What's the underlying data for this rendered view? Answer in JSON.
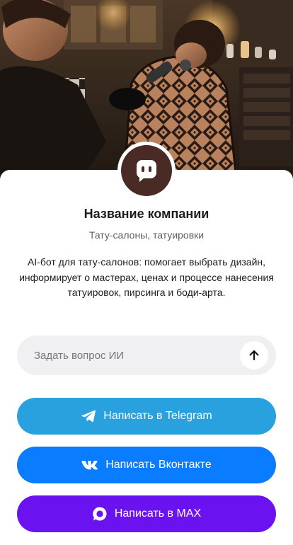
{
  "hero": {
    "image_icon": "tattoo-salon-photo"
  },
  "company": {
    "avatar_icon": "chat-bot-icon",
    "avatar_color": "#4a2a24",
    "name": "Название компании",
    "category": "Тату-салоны, татуировки",
    "description": "AI-бот для тату-салонов: помогает выбрать дизайн, информирует о мастерах, ценах и процессе нанесения татуировок, пирсинга и боди-арта."
  },
  "ask": {
    "placeholder": "Задать вопрос ИИ",
    "value": "",
    "send_icon": "arrow-up-icon"
  },
  "actions": [
    {
      "label": "Написать в Telegram",
      "icon": "telegram-icon",
      "color": "#2aa1df"
    },
    {
      "label": "Написать Вконтакте",
      "icon": "vk-icon",
      "color": "#0a7cff"
    },
    {
      "label": "Написать в MAX",
      "icon": "max-icon",
      "color": "#6a13f0"
    }
  ]
}
